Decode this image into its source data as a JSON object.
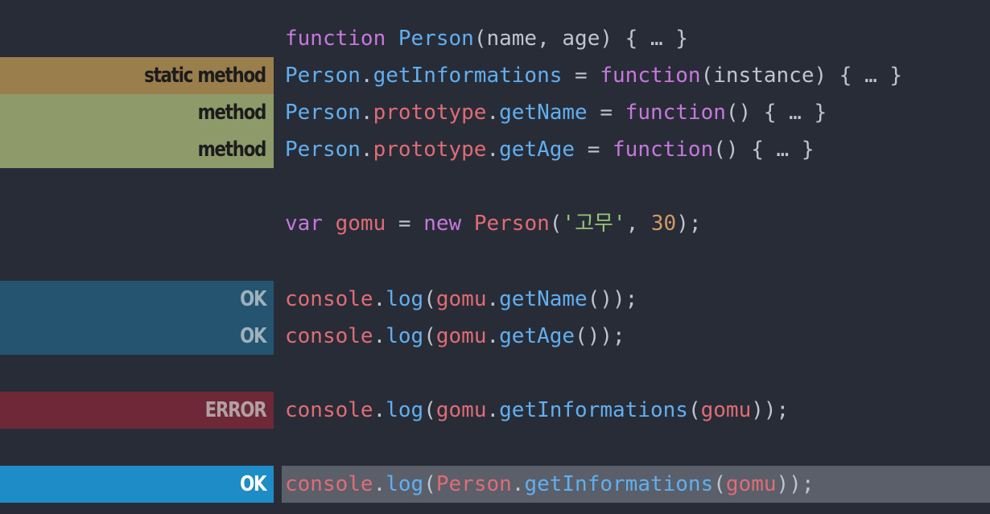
{
  "colors": {
    "background": "#282c37",
    "keyword": "#c678dd",
    "identifier": "#61afef",
    "variable": "#e06c75",
    "string": "#98c379",
    "number": "#d19a66",
    "punct": "#bfc5d0",
    "highlight": "#5a5f6a"
  },
  "lines": [
    {
      "label": "",
      "label_type": "",
      "highlight": false,
      "tokens": [
        {
          "text": "function",
          "cls": "keyword"
        },
        {
          "text": " ",
          "cls": "punct"
        },
        {
          "text": "Person",
          "cls": "identifier"
        },
        {
          "text": "(name, age) { … }",
          "cls": "punct"
        }
      ]
    },
    {
      "label": "static method",
      "label_type": "static",
      "highlight": false,
      "tokens": [
        {
          "text": "Person",
          "cls": "identifier"
        },
        {
          "text": ".",
          "cls": "punct"
        },
        {
          "text": "getInformations",
          "cls": "identifier"
        },
        {
          "text": " = ",
          "cls": "punct"
        },
        {
          "text": "function",
          "cls": "keyword"
        },
        {
          "text": "(instance) { … }",
          "cls": "punct"
        }
      ]
    },
    {
      "label": "method",
      "label_type": "method",
      "highlight": false,
      "tokens": [
        {
          "text": "Person",
          "cls": "identifier"
        },
        {
          "text": ".",
          "cls": "punct"
        },
        {
          "text": "prototype",
          "cls": "variable"
        },
        {
          "text": ".",
          "cls": "punct"
        },
        {
          "text": "getName",
          "cls": "identifier"
        },
        {
          "text": " = ",
          "cls": "punct"
        },
        {
          "text": "function",
          "cls": "keyword"
        },
        {
          "text": "() { … }",
          "cls": "punct"
        }
      ]
    },
    {
      "label": "method",
      "label_type": "method",
      "highlight": false,
      "tokens": [
        {
          "text": "Person",
          "cls": "identifier"
        },
        {
          "text": ".",
          "cls": "punct"
        },
        {
          "text": "prototype",
          "cls": "variable"
        },
        {
          "text": ".",
          "cls": "punct"
        },
        {
          "text": "getAge",
          "cls": "identifier"
        },
        {
          "text": " = ",
          "cls": "punct"
        },
        {
          "text": "function",
          "cls": "keyword"
        },
        {
          "text": "() { … }",
          "cls": "punct"
        }
      ]
    },
    {
      "label": "",
      "label_type": "",
      "highlight": false,
      "tokens": [
        {
          "text": "var",
          "cls": "keyword"
        },
        {
          "text": " ",
          "cls": "punct"
        },
        {
          "text": "gomu",
          "cls": "variable"
        },
        {
          "text": " = ",
          "cls": "punct"
        },
        {
          "text": "new",
          "cls": "keyword"
        },
        {
          "text": " ",
          "cls": "punct"
        },
        {
          "text": "Person",
          "cls": "variable"
        },
        {
          "text": "(",
          "cls": "punct"
        },
        {
          "text": "'고무'",
          "cls": "string"
        },
        {
          "text": ", ",
          "cls": "punct"
        },
        {
          "text": "30",
          "cls": "number"
        },
        {
          "text": ");",
          "cls": "punct"
        }
      ]
    },
    {
      "label": "OK",
      "label_type": "ok",
      "highlight": false,
      "tokens": [
        {
          "text": "console",
          "cls": "variable"
        },
        {
          "text": ".",
          "cls": "punct"
        },
        {
          "text": "log",
          "cls": "identifier"
        },
        {
          "text": "(",
          "cls": "punct"
        },
        {
          "text": "gomu",
          "cls": "variable"
        },
        {
          "text": ".",
          "cls": "punct"
        },
        {
          "text": "getName",
          "cls": "identifier"
        },
        {
          "text": "());",
          "cls": "punct"
        }
      ]
    },
    {
      "label": "OK",
      "label_type": "ok",
      "highlight": false,
      "tokens": [
        {
          "text": "console",
          "cls": "variable"
        },
        {
          "text": ".",
          "cls": "punct"
        },
        {
          "text": "log",
          "cls": "identifier"
        },
        {
          "text": "(",
          "cls": "punct"
        },
        {
          "text": "gomu",
          "cls": "variable"
        },
        {
          "text": ".",
          "cls": "punct"
        },
        {
          "text": "getAge",
          "cls": "identifier"
        },
        {
          "text": "());",
          "cls": "punct"
        }
      ]
    },
    {
      "label": "ERROR",
      "label_type": "error",
      "highlight": false,
      "tokens": [
        {
          "text": "console",
          "cls": "variable"
        },
        {
          "text": ".",
          "cls": "punct"
        },
        {
          "text": "log",
          "cls": "identifier"
        },
        {
          "text": "(",
          "cls": "punct"
        },
        {
          "text": "gomu",
          "cls": "variable"
        },
        {
          "text": ".",
          "cls": "punct"
        },
        {
          "text": "getInformations",
          "cls": "identifier"
        },
        {
          "text": "(",
          "cls": "punct"
        },
        {
          "text": "gomu",
          "cls": "variable"
        },
        {
          "text": "));",
          "cls": "punct"
        }
      ]
    },
    {
      "label": "OK",
      "label_type": "ok-hl",
      "highlight": true,
      "tokens": [
        {
          "text": "console",
          "cls": "variable"
        },
        {
          "text": ".",
          "cls": "punct"
        },
        {
          "text": "log",
          "cls": "identifier"
        },
        {
          "text": "(",
          "cls": "punct"
        },
        {
          "text": "Person",
          "cls": "variable"
        },
        {
          "text": ".",
          "cls": "punct"
        },
        {
          "text": "getInformations",
          "cls": "identifier"
        },
        {
          "text": "(",
          "cls": "punct"
        },
        {
          "text": "gomu",
          "cls": "variable"
        },
        {
          "text": "));",
          "cls": "punct"
        }
      ]
    }
  ]
}
